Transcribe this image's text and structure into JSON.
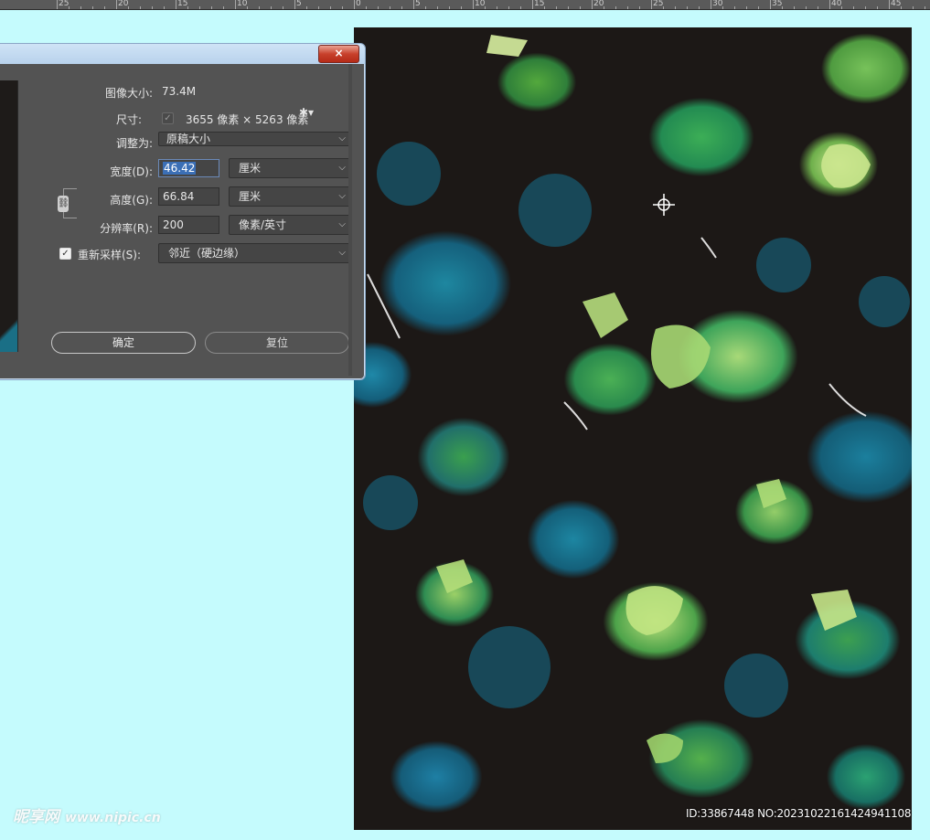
{
  "ruler": {
    "labels": [
      "25",
      "20",
      "15",
      "10",
      "5",
      "0",
      "5",
      "10",
      "15",
      "20",
      "25",
      "30",
      "35",
      "40",
      "45"
    ]
  },
  "dialog": {
    "close_label": "×",
    "image_size_label": "图像大小:",
    "image_size_value": "73.4M",
    "dimensions_label": "尺寸:",
    "dimensions_value": "3655 像素 × 5263 像素",
    "fit_to_label": "调整为:",
    "fit_to_value": "原稿大小",
    "width_label": "宽度(D):",
    "width_value": "46.42",
    "width_unit": "厘米",
    "height_label": "高度(G):",
    "height_value": "66.84",
    "height_unit": "厘米",
    "resolution_label": "分辨率(R):",
    "resolution_value": "200",
    "resolution_unit": "像素/英寸",
    "resample_label": "重新采样(S):",
    "resample_value": "邻近（硬边缘）",
    "ok_label": "确定",
    "reset_label": "复位"
  },
  "watermark": {
    "logo": "昵享网",
    "site": "www.nipic.cn",
    "id": "ID:33867448 NO:20231022161424941108"
  },
  "colors": {
    "app_background": "#C5FBFD",
    "dialog_background": "#535353",
    "titlebar": "#B8D2EC",
    "close_button": "#C8412C",
    "selection": "#3B6FB6"
  }
}
